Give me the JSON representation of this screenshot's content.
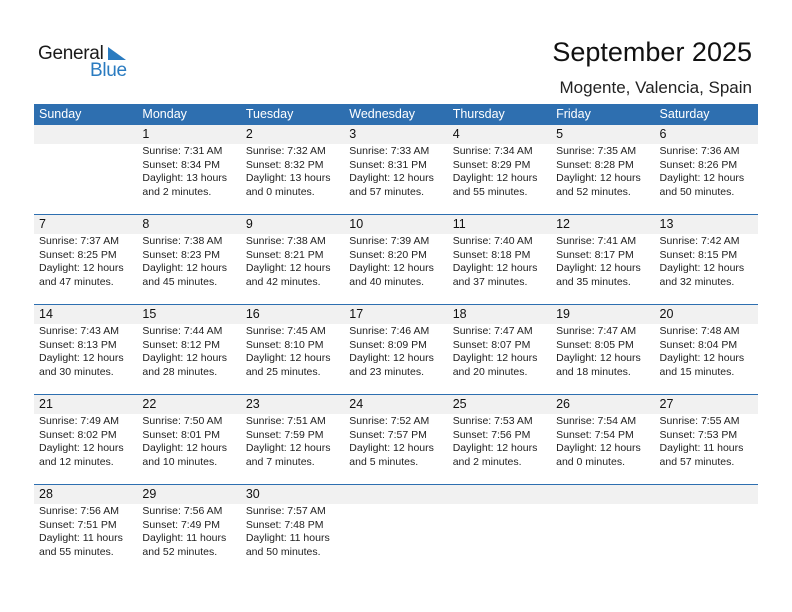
{
  "logo": {
    "line1": "General",
    "line2": "Blue"
  },
  "title": "September 2025",
  "location": "Mogente, Valencia, Spain",
  "colors": {
    "header": "#2e6fb0",
    "brand": "#2a7bc0"
  },
  "weekdays": [
    "Sunday",
    "Monday",
    "Tuesday",
    "Wednesday",
    "Thursday",
    "Friday",
    "Saturday"
  ],
  "weeks": [
    [
      null,
      {
        "day": "1",
        "sunrise": "Sunrise: 7:31 AM",
        "sunset": "Sunset: 8:34 PM",
        "daylight1": "Daylight: 13 hours",
        "daylight2": "and 2 minutes."
      },
      {
        "day": "2",
        "sunrise": "Sunrise: 7:32 AM",
        "sunset": "Sunset: 8:32 PM",
        "daylight1": "Daylight: 13 hours",
        "daylight2": "and 0 minutes."
      },
      {
        "day": "3",
        "sunrise": "Sunrise: 7:33 AM",
        "sunset": "Sunset: 8:31 PM",
        "daylight1": "Daylight: 12 hours",
        "daylight2": "and 57 minutes."
      },
      {
        "day": "4",
        "sunrise": "Sunrise: 7:34 AM",
        "sunset": "Sunset: 8:29 PM",
        "daylight1": "Daylight: 12 hours",
        "daylight2": "and 55 minutes."
      },
      {
        "day": "5",
        "sunrise": "Sunrise: 7:35 AM",
        "sunset": "Sunset: 8:28 PM",
        "daylight1": "Daylight: 12 hours",
        "daylight2": "and 52 minutes."
      },
      {
        "day": "6",
        "sunrise": "Sunrise: 7:36 AM",
        "sunset": "Sunset: 8:26 PM",
        "daylight1": "Daylight: 12 hours",
        "daylight2": "and 50 minutes."
      }
    ],
    [
      {
        "day": "7",
        "sunrise": "Sunrise: 7:37 AM",
        "sunset": "Sunset: 8:25 PM",
        "daylight1": "Daylight: 12 hours",
        "daylight2": "and 47 minutes."
      },
      {
        "day": "8",
        "sunrise": "Sunrise: 7:38 AM",
        "sunset": "Sunset: 8:23 PM",
        "daylight1": "Daylight: 12 hours",
        "daylight2": "and 45 minutes."
      },
      {
        "day": "9",
        "sunrise": "Sunrise: 7:38 AM",
        "sunset": "Sunset: 8:21 PM",
        "daylight1": "Daylight: 12 hours",
        "daylight2": "and 42 minutes."
      },
      {
        "day": "10",
        "sunrise": "Sunrise: 7:39 AM",
        "sunset": "Sunset: 8:20 PM",
        "daylight1": "Daylight: 12 hours",
        "daylight2": "and 40 minutes."
      },
      {
        "day": "11",
        "sunrise": "Sunrise: 7:40 AM",
        "sunset": "Sunset: 8:18 PM",
        "daylight1": "Daylight: 12 hours",
        "daylight2": "and 37 minutes."
      },
      {
        "day": "12",
        "sunrise": "Sunrise: 7:41 AM",
        "sunset": "Sunset: 8:17 PM",
        "daylight1": "Daylight: 12 hours",
        "daylight2": "and 35 minutes."
      },
      {
        "day": "13",
        "sunrise": "Sunrise: 7:42 AM",
        "sunset": "Sunset: 8:15 PM",
        "daylight1": "Daylight: 12 hours",
        "daylight2": "and 32 minutes."
      }
    ],
    [
      {
        "day": "14",
        "sunrise": "Sunrise: 7:43 AM",
        "sunset": "Sunset: 8:13 PM",
        "daylight1": "Daylight: 12 hours",
        "daylight2": "and 30 minutes."
      },
      {
        "day": "15",
        "sunrise": "Sunrise: 7:44 AM",
        "sunset": "Sunset: 8:12 PM",
        "daylight1": "Daylight: 12 hours",
        "daylight2": "and 28 minutes."
      },
      {
        "day": "16",
        "sunrise": "Sunrise: 7:45 AM",
        "sunset": "Sunset: 8:10 PM",
        "daylight1": "Daylight: 12 hours",
        "daylight2": "and 25 minutes."
      },
      {
        "day": "17",
        "sunrise": "Sunrise: 7:46 AM",
        "sunset": "Sunset: 8:09 PM",
        "daylight1": "Daylight: 12 hours",
        "daylight2": "and 23 minutes."
      },
      {
        "day": "18",
        "sunrise": "Sunrise: 7:47 AM",
        "sunset": "Sunset: 8:07 PM",
        "daylight1": "Daylight: 12 hours",
        "daylight2": "and 20 minutes."
      },
      {
        "day": "19",
        "sunrise": "Sunrise: 7:47 AM",
        "sunset": "Sunset: 8:05 PM",
        "daylight1": "Daylight: 12 hours",
        "daylight2": "and 18 minutes."
      },
      {
        "day": "20",
        "sunrise": "Sunrise: 7:48 AM",
        "sunset": "Sunset: 8:04 PM",
        "daylight1": "Daylight: 12 hours",
        "daylight2": "and 15 minutes."
      }
    ],
    [
      {
        "day": "21",
        "sunrise": "Sunrise: 7:49 AM",
        "sunset": "Sunset: 8:02 PM",
        "daylight1": "Daylight: 12 hours",
        "daylight2": "and 12 minutes."
      },
      {
        "day": "22",
        "sunrise": "Sunrise: 7:50 AM",
        "sunset": "Sunset: 8:01 PM",
        "daylight1": "Daylight: 12 hours",
        "daylight2": "and 10 minutes."
      },
      {
        "day": "23",
        "sunrise": "Sunrise: 7:51 AM",
        "sunset": "Sunset: 7:59 PM",
        "daylight1": "Daylight: 12 hours",
        "daylight2": "and 7 minutes."
      },
      {
        "day": "24",
        "sunrise": "Sunrise: 7:52 AM",
        "sunset": "Sunset: 7:57 PM",
        "daylight1": "Daylight: 12 hours",
        "daylight2": "and 5 minutes."
      },
      {
        "day": "25",
        "sunrise": "Sunrise: 7:53 AM",
        "sunset": "Sunset: 7:56 PM",
        "daylight1": "Daylight: 12 hours",
        "daylight2": "and 2 minutes."
      },
      {
        "day": "26",
        "sunrise": "Sunrise: 7:54 AM",
        "sunset": "Sunset: 7:54 PM",
        "daylight1": "Daylight: 12 hours",
        "daylight2": "and 0 minutes."
      },
      {
        "day": "27",
        "sunrise": "Sunrise: 7:55 AM",
        "sunset": "Sunset: 7:53 PM",
        "daylight1": "Daylight: 11 hours",
        "daylight2": "and 57 minutes."
      }
    ],
    [
      {
        "day": "28",
        "sunrise": "Sunrise: 7:56 AM",
        "sunset": "Sunset: 7:51 PM",
        "daylight1": "Daylight: 11 hours",
        "daylight2": "and 55 minutes."
      },
      {
        "day": "29",
        "sunrise": "Sunrise: 7:56 AM",
        "sunset": "Sunset: 7:49 PM",
        "daylight1": "Daylight: 11 hours",
        "daylight2": "and 52 minutes."
      },
      {
        "day": "30",
        "sunrise": "Sunrise: 7:57 AM",
        "sunset": "Sunset: 7:48 PM",
        "daylight1": "Daylight: 11 hours",
        "daylight2": "and 50 minutes."
      },
      null,
      null,
      null,
      null
    ]
  ]
}
